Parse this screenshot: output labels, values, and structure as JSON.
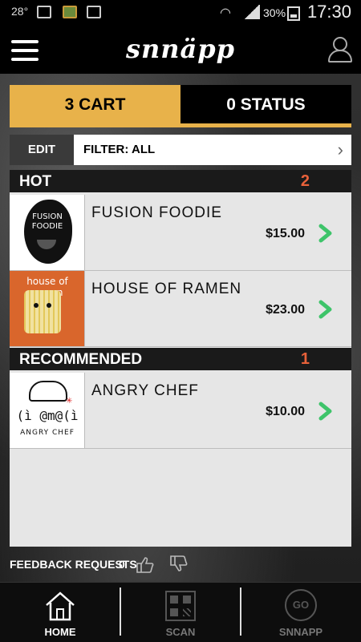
{
  "status_bar": {
    "temperature": "28°",
    "battery_pct": "30%",
    "time": "17:30",
    "icons": [
      "image-icon",
      "app-icon",
      "screenshot-icon",
      "wifi-icon",
      "signal-icon",
      "battery-icon"
    ]
  },
  "header": {
    "logo": "snnäpp",
    "icons": [
      "menu-icon",
      "profile-icon"
    ]
  },
  "tabs": {
    "cart_label": "3 CART",
    "status_label": "0 STATUS",
    "active": "cart",
    "accent_color": "#e8b24a"
  },
  "filter": {
    "edit_label": "EDIT",
    "label": "FILTER:  ALL",
    "chevron_icon": "chevron-right-icon"
  },
  "sections": {
    "hot": {
      "title": "HOT",
      "count": "2",
      "items": [
        {
          "name": "FUSION FOODIE",
          "price": "$15.00",
          "logo_text": "FUSION\nFOODIE"
        },
        {
          "name": "HOUSE OF RAMEN",
          "price": "$23.00",
          "logo_text": "house of ramen"
        }
      ]
    },
    "recommended": {
      "title": "RECOMMENDED",
      "count": "1",
      "items": [
        {
          "name": "ANGRY CHEF",
          "price": "$10.00",
          "logo_face": "(ì @m@(ì",
          "logo_text": "ANGRY CHEF"
        }
      ]
    },
    "count_color": "#e8613a",
    "arrow_color": "#3ec46a"
  },
  "feedback": {
    "label": "FEEDBACK REQUESTS",
    "count": "0",
    "icons": [
      "thumbs-up-icon",
      "thumbs-down-icon"
    ]
  },
  "bottom_nav": {
    "items": [
      {
        "label": "HOME",
        "icon": "home-icon",
        "active": true
      },
      {
        "label": "SCAN",
        "icon": "qr-code-icon",
        "active": false
      },
      {
        "label": "SNNAPP",
        "icon": "go-icon",
        "active": false
      }
    ],
    "go_text": "GO"
  }
}
